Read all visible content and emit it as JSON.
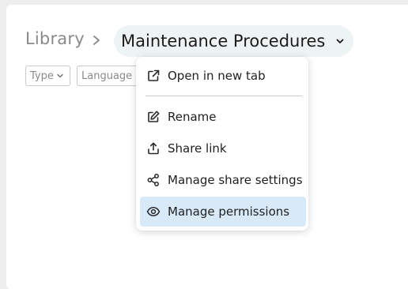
{
  "breadcrumb": {
    "root": "Library",
    "separator": ">",
    "current": "Maintenance Procedures"
  },
  "filters": {
    "type": "Type",
    "language": "Language"
  },
  "menu": {
    "items": [
      {
        "label": "Open in new tab",
        "icon": "external-link-icon"
      },
      {
        "label": "Rename",
        "icon": "edit-icon"
      },
      {
        "label": "Share link",
        "icon": "share-upload-icon"
      },
      {
        "label": "Manage share settings",
        "icon": "share-nodes-icon"
      },
      {
        "label": "Manage permissions",
        "icon": "eye-icon",
        "highlighted": true
      }
    ]
  },
  "colors": {
    "highlight": "#d8eaf8",
    "current_crumb_bg": "#eef3f4",
    "muted_text": "#8a8a8a"
  }
}
